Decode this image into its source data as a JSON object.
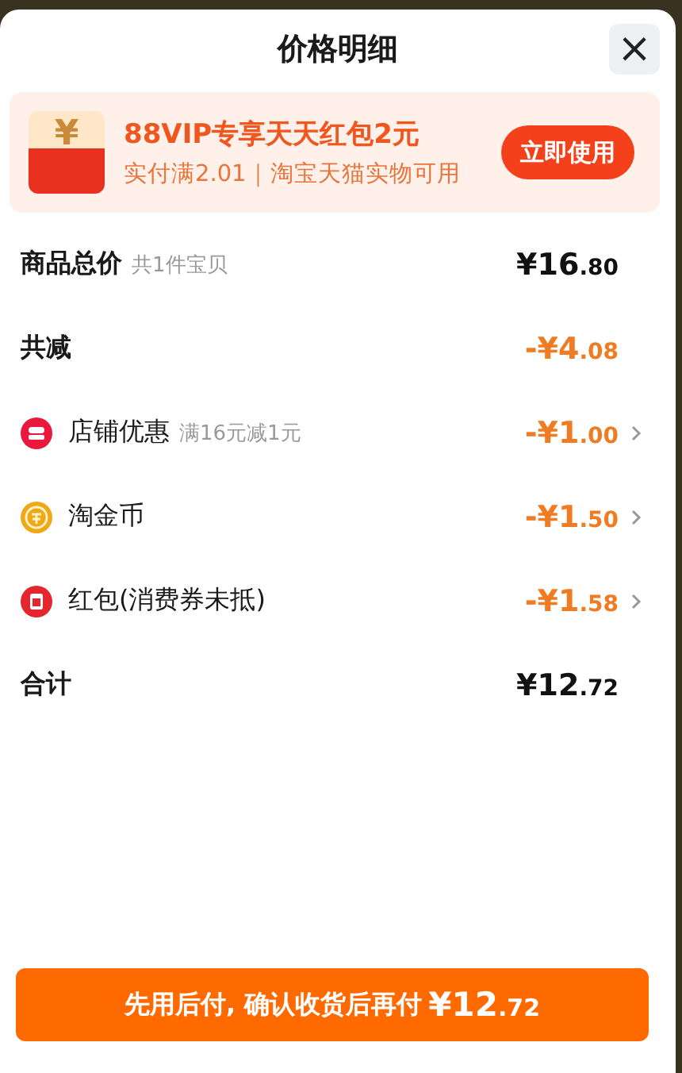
{
  "sheet": {
    "title": "价格明细",
    "close": "×"
  },
  "promo": {
    "title": "88VIP专享天天红包2元",
    "subtitle": "实付满2.01｜淘宝天猫实物可用",
    "action": "立即使用",
    "icon_symbol": "¥"
  },
  "rows": [
    {
      "kind": "total",
      "label": "商品总价",
      "hint": "共1件宝贝",
      "amount": "¥16.80"
    },
    {
      "kind": "reduction",
      "label": "共减",
      "amount": "-¥4.08"
    },
    {
      "kind": "store",
      "label": "店铺优惠",
      "hint": "满16元减1元",
      "amount": "-¥1.00"
    },
    {
      "kind": "coin",
      "label": "淘金币",
      "amount": "-¥1.50"
    },
    {
      "kind": "packet",
      "label": "红包(消费券未抵)",
      "amount": "-¥1.58"
    },
    {
      "kind": "total",
      "label": "合计",
      "amount": "¥12.72"
    }
  ],
  "pay_button": {
    "label": "先用后付, 确认收货后再付",
    "amount": "¥12.72"
  }
}
